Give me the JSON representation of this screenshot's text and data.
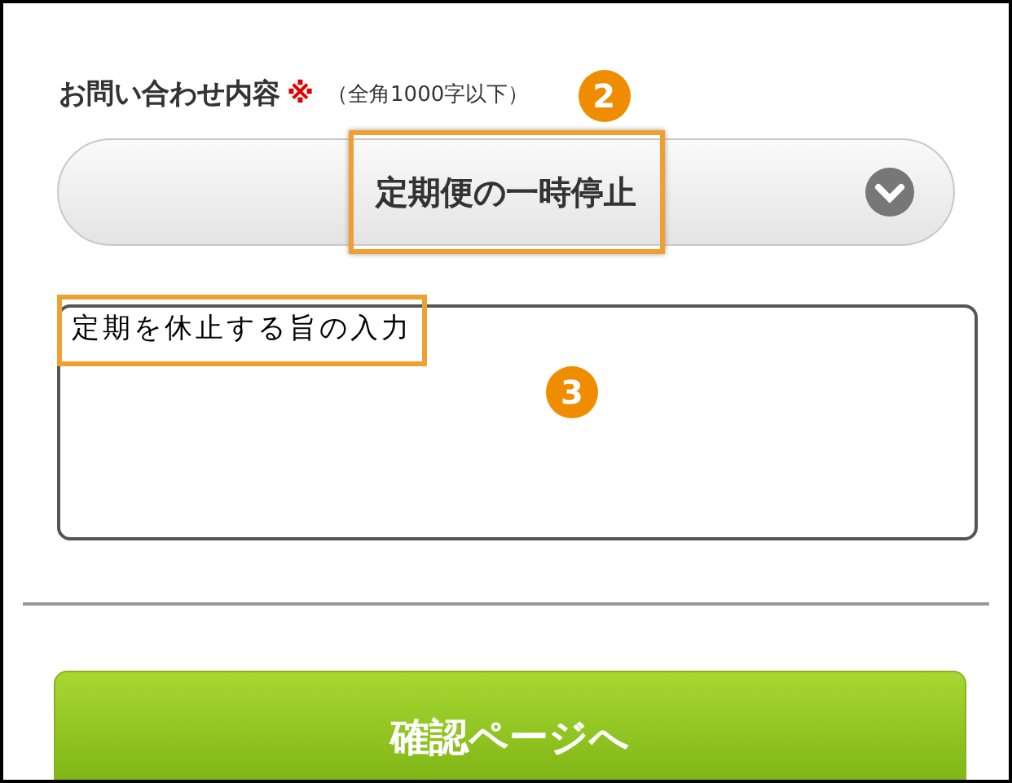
{
  "field": {
    "label": "お問い合わせ内容",
    "required_mark": "※",
    "note": "（全角1000字以下）"
  },
  "select": {
    "value": "定期便の一時停止"
  },
  "textarea": {
    "value": "定期を休止する旨の入力"
  },
  "callouts": [
    {
      "number": "2"
    },
    {
      "number": "3"
    }
  ],
  "submit_button": {
    "label": "確認ページへ"
  }
}
